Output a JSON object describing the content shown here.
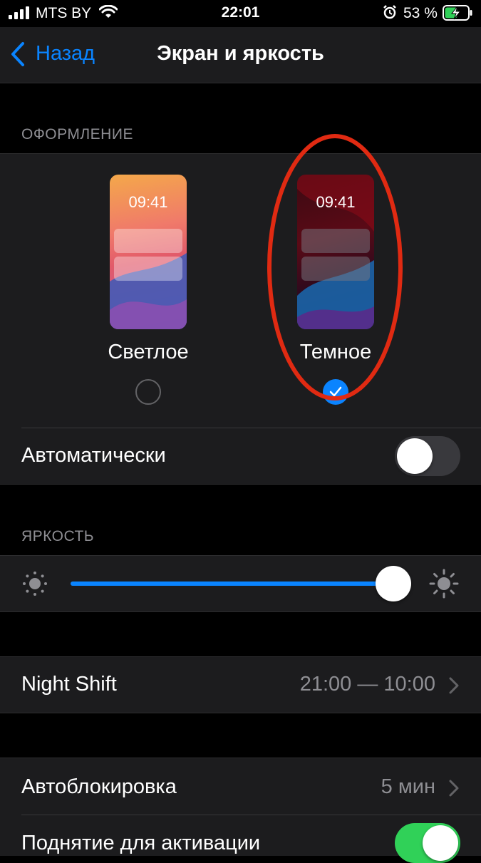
{
  "status_bar": {
    "carrier": "MTS BY",
    "time": "22:01",
    "battery": "53 %",
    "icons": [
      "cellular-signal-icon",
      "wifi-icon",
      "alarm-icon",
      "battery-charging-icon"
    ]
  },
  "nav": {
    "back_label": "Назад",
    "title": "Экран и яркость"
  },
  "appearance": {
    "header": "ОФОРМЛЕНИЕ",
    "light": {
      "label": "Светлое",
      "preview_time": "09:41",
      "selected": false
    },
    "dark": {
      "label": "Темное",
      "preview_time": "09:41",
      "selected": true
    },
    "auto_label": "Автоматически",
    "auto_on": false
  },
  "brightness": {
    "header": "ЯРКОСТЬ",
    "level": 0.95
  },
  "night_shift": {
    "label": "Night Shift",
    "value": "21:00 — 10:00"
  },
  "autolock": {
    "label": "Автоблокировка",
    "value": "5 мин"
  },
  "raise_to_wake": {
    "label": "Поднятие для активации",
    "on": true
  },
  "colors": {
    "accent": "#0a84ff",
    "toggle_on": "#30d158",
    "annotation": "#e02a12",
    "cell_bg": "#1c1c1e"
  }
}
